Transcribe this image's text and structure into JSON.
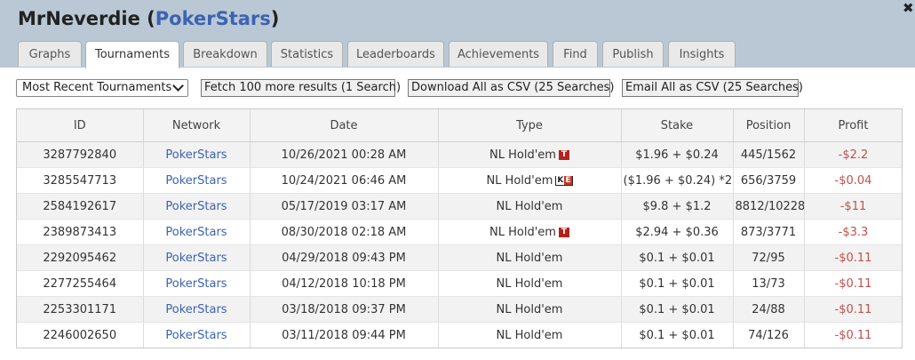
{
  "header": {
    "player": "MrNeverdie",
    "network": "PokerStars",
    "open_paren": " (",
    "close_paren": ")"
  },
  "tabs": [
    {
      "label": "Graphs"
    },
    {
      "label": "Tournaments"
    },
    {
      "label": "Breakdown"
    },
    {
      "label": "Statistics"
    },
    {
      "label": "Leaderboards"
    },
    {
      "label": "Achievements"
    },
    {
      "label": "Find"
    },
    {
      "label": "Publish"
    },
    {
      "label": "Insights"
    }
  ],
  "toolbar": {
    "filter_selected": "Most Recent Tournaments",
    "fetch_label": "Fetch 100 more results (1 Search)",
    "download_label": "Download All as CSV (25 Searches)",
    "email_label": "Email All as CSV (25 Searches)"
  },
  "table": {
    "columns": [
      "ID",
      "Network",
      "Date",
      "Type",
      "Stake",
      "Position",
      "Profit"
    ],
    "rows": [
      {
        "id": "3287792840",
        "network": "PokerStars",
        "date": "10/26/2021 00:28 AM",
        "type": "NL Hold'em",
        "badge": "T",
        "stake": "$1.96 + $0.24",
        "position": "445/1562",
        "profit": "-$2.2"
      },
      {
        "id": "3285547713",
        "network": "PokerStars",
        "date": "10/24/2021 06:46 AM",
        "type": "NL Hold'em",
        "badge": "KO",
        "stake": "($1.96 + $0.24) *2",
        "position": "656/3759",
        "profit": "-$0.04"
      },
      {
        "id": "2584192617",
        "network": "PokerStars",
        "date": "05/17/2019 03:17 AM",
        "type": "NL Hold'em",
        "badge": "",
        "stake": "$9.8 + $1.2",
        "position": "8812/10228",
        "profit": "-$11"
      },
      {
        "id": "2389873413",
        "network": "PokerStars",
        "date": "08/30/2018 02:18 AM",
        "type": "NL Hold'em",
        "badge": "T",
        "stake": "$2.94 + $0.36",
        "position": "873/3771",
        "profit": "-$3.3"
      },
      {
        "id": "2292095462",
        "network": "PokerStars",
        "date": "04/29/2018 09:43 PM",
        "type": "NL Hold'em",
        "badge": "",
        "stake": "$0.1 + $0.01",
        "position": "72/95",
        "profit": "-$0.11"
      },
      {
        "id": "2277255464",
        "network": "PokerStars",
        "date": "04/12/2018 10:18 PM",
        "type": "NL Hold'em",
        "badge": "",
        "stake": "$0.1 + $0.01",
        "position": "13/73",
        "profit": "-$0.11"
      },
      {
        "id": "2253301171",
        "network": "PokerStars",
        "date": "03/18/2018 09:37 PM",
        "type": "NL Hold'em",
        "badge": "",
        "stake": "$0.1 + $0.01",
        "position": "24/88",
        "profit": "-$0.11"
      },
      {
        "id": "2246002650",
        "network": "PokerStars",
        "date": "03/11/2018 09:44 PM",
        "type": "NL Hold'em",
        "badge": "",
        "stake": "$0.1 + $0.01",
        "position": "74/126",
        "profit": "-$0.11"
      }
    ]
  },
  "badges": {
    "T": {
      "text": "T",
      "color": "#b3231c"
    },
    "KO": {
      "k": "K",
      "e": "E",
      "color": "#c0392b"
    }
  },
  "colors": {
    "header_bg": "#b9c8d4",
    "link": "#3d63b0",
    "negative": "#c0504d"
  },
  "icons": {
    "close": "close-icon",
    "dropdown": "chevron-down-icon"
  },
  "close_glyph": "✖"
}
